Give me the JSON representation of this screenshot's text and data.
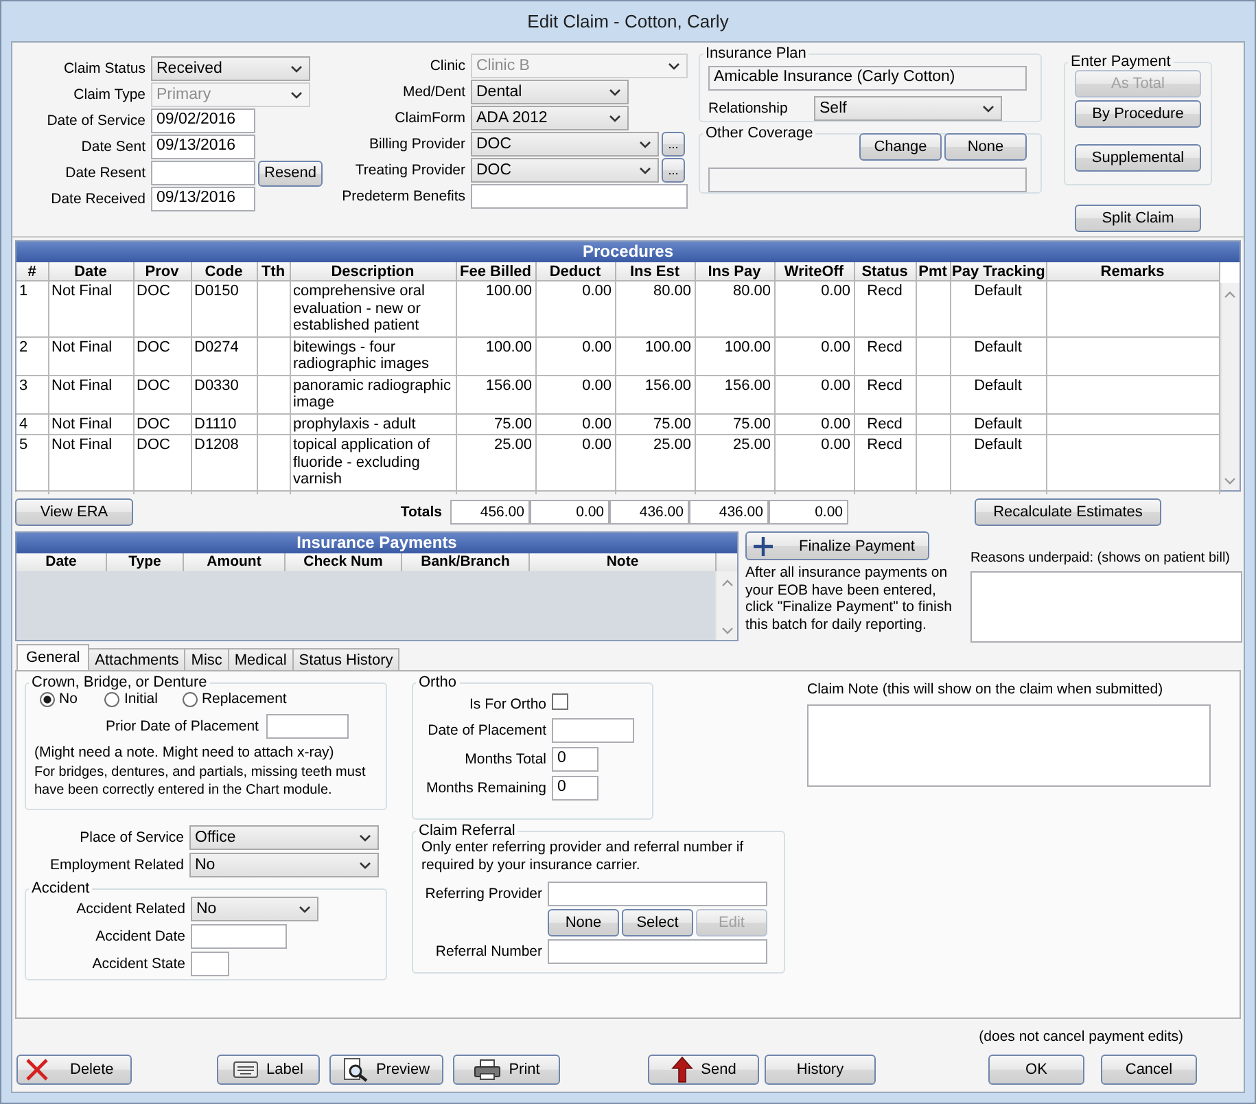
{
  "window": {
    "title": "Edit Claim - Cotton, Carly"
  },
  "claim_fields": [
    {
      "label": "Claim Status",
      "kind": "dropdown",
      "value": "Received",
      "disabled": false
    },
    {
      "label": "Claim Type",
      "kind": "dropdown",
      "value": "Primary",
      "disabled": true
    },
    {
      "label": "Date of Service",
      "kind": "text",
      "value": "09/02/2016",
      "disabled": false
    },
    {
      "label": "Date Sent",
      "kind": "text",
      "value": "09/13/2016",
      "disabled": false
    },
    {
      "label": "Date Resent",
      "kind": "text",
      "button": "Resend",
      "disabled": false
    },
    {
      "label": "Date Received",
      "kind": "text",
      "value": "09/13/2016",
      "disabled": false
    }
  ],
  "provider_fields": [
    {
      "label": "Clinic",
      "kind": "dropdown",
      "value": "Clinic B",
      "disabled": true
    },
    {
      "label": "Med/Dent",
      "kind": "dropdown",
      "value": "Dental",
      "disabled": false
    },
    {
      "label": "ClaimForm",
      "kind": "dropdown",
      "value": "ADA 2012",
      "disabled": false
    },
    {
      "label": "Billing Provider",
      "kind": "dropdown",
      "value": "DOC",
      "button": "...",
      "disabled": false
    },
    {
      "label": "Treating Provider",
      "kind": "dropdown",
      "value": "DOC",
      "button": "...",
      "disabled": false
    },
    {
      "label": "Predeterm Benefits",
      "kind": "text",
      "disabled": false
    }
  ],
  "insurance_plan": {
    "title": "Insurance Plan",
    "plan": "Amicable Insurance (Carly Cotton)",
    "relationship_label": "Relationship",
    "relationship": "Self"
  },
  "other_coverage": {
    "title": "Other Coverage",
    "buttons": [
      "Change",
      "None"
    ]
  },
  "enter_payment": {
    "title": "Enter Payment",
    "buttons": [
      {
        "label": "As Total",
        "disabled": true
      },
      {
        "label": "By Procedure",
        "disabled": false
      },
      {
        "label": "Supplemental",
        "disabled": false
      }
    ]
  },
  "split_claim": "Split Claim",
  "procedures": {
    "title": "Procedures",
    "columns": [
      "#",
      "Date",
      "Prov",
      "Code",
      "Tth",
      "Description",
      "Fee Billed",
      "Deduct",
      "Ins Est",
      "Ins Pay",
      "WriteOff",
      "Status",
      "Pmt",
      "Pay Tracking",
      "Remarks"
    ],
    "rows": [
      {
        "num": "1",
        "date": "Not Final",
        "prov": "DOC",
        "code": "D0150",
        "description": "comprehensive oral evaluation - new or established patient",
        "fee_billed": "100.00",
        "deduct": "0.00",
        "ins_est": "80.00",
        "ins_pay": "80.00",
        "writeoff": "0.00",
        "status": "Recd",
        "pay_tracking": "Default"
      },
      {
        "num": "2",
        "date": "Not Final",
        "prov": "DOC",
        "code": "D0274",
        "description": "bitewings - four radiographic images",
        "fee_billed": "100.00",
        "deduct": "0.00",
        "ins_est": "100.00",
        "ins_pay": "100.00",
        "writeoff": "0.00",
        "status": "Recd",
        "pay_tracking": "Default"
      },
      {
        "num": "3",
        "date": "Not Final",
        "prov": "DOC",
        "code": "D0330",
        "description": "panoramic radiographic image",
        "fee_billed": "156.00",
        "deduct": "0.00",
        "ins_est": "156.00",
        "ins_pay": "156.00",
        "writeoff": "0.00",
        "status": "Recd",
        "pay_tracking": "Default"
      },
      {
        "num": "4",
        "date": "Not Final",
        "prov": "DOC",
        "code": "D1110",
        "description": "prophylaxis - adult",
        "fee_billed": "75.00",
        "deduct": "0.00",
        "ins_est": "75.00",
        "ins_pay": "75.00",
        "writeoff": "0.00",
        "status": "Recd",
        "pay_tracking": "Default"
      },
      {
        "num": "5",
        "date": "Not Final",
        "prov": "DOC",
        "code": "D1208",
        "description": "topical application of fluoride - excluding varnish",
        "fee_billed": "25.00",
        "deduct": "0.00",
        "ins_est": "25.00",
        "ins_pay": "25.00",
        "writeoff": "0.00",
        "status": "Recd",
        "pay_tracking": "Default"
      }
    ]
  },
  "view_era": "View ERA",
  "totals": {
    "label": "Totals",
    "values": [
      "456.00",
      "0.00",
      "436.00",
      "436.00",
      "0.00"
    ]
  },
  "recalculate": "Recalculate Estimates",
  "insurance_payments": {
    "title": "Insurance Payments",
    "columns": [
      "Date",
      "Type",
      "Amount",
      "Check Num",
      "Bank/Branch",
      "Note"
    ]
  },
  "finalize": {
    "button": "Finalize Payment",
    "note": "After all insurance payments on your EOB have been entered, click \"Finalize Payment\" to finish this batch for daily reporting."
  },
  "reasons_underpaid": {
    "label": "Reasons underpaid:  (shows on patient bill)"
  },
  "tabs": [
    {
      "label": "General",
      "selected": true
    },
    {
      "label": "Attachments",
      "selected": false
    },
    {
      "label": "Misc",
      "selected": false
    },
    {
      "label": "Medical",
      "selected": false
    },
    {
      "label": "Status History",
      "selected": false
    }
  ],
  "general": {
    "crown": {
      "title": "Crown, Bridge, or Denture",
      "options": [
        {
          "label": "No",
          "selected": true
        },
        {
          "label": "Initial",
          "selected": false
        },
        {
          "label": "Replacement",
          "selected": false
        }
      ],
      "prior_date_label": "Prior Date of Placement",
      "note": "(Might need a note. Might need to attach x-ray)",
      "warning": "For bridges, dentures, and partials, missing teeth must have been correctly entered in the Chart module."
    },
    "service_fields": [
      {
        "label": "Place of Service",
        "value": "Office"
      },
      {
        "label": "Employment Related",
        "value": "No"
      }
    ],
    "accident": {
      "title": "Accident",
      "fields": [
        {
          "label": "Accident Related",
          "kind": "dropdown",
          "value": "No"
        },
        {
          "label": "Accident Date",
          "kind": "date"
        },
        {
          "label": "Accident State",
          "kind": "state"
        }
      ]
    },
    "ortho": {
      "title": "Ortho",
      "is_for_ortho": {
        "label": "Is For Ortho",
        "checked": false
      },
      "fields": [
        {
          "label": "Date of Placement",
          "kind": "date"
        },
        {
          "label": "Months Total",
          "kind": "count",
          "value": "0"
        },
        {
          "label": "Months Remaining",
          "kind": "count",
          "value": "0"
        }
      ]
    },
    "referral": {
      "title": "Claim Referral",
      "note": "Only enter referring provider and referral number if required by your insurance carrier.",
      "provider_label": "Referring Provider",
      "buttons": [
        {
          "label": "None",
          "disabled": false
        },
        {
          "label": "Select",
          "disabled": false
        },
        {
          "label": "Edit",
          "disabled": true
        }
      ],
      "number_label": "Referral Number"
    },
    "claim_note": {
      "label": "Claim Note (this will show on the claim when submitted)"
    }
  },
  "footer": {
    "note": "(does not cancel payment edits)",
    "buttons": [
      {
        "label": "Delete",
        "kind": "delete"
      },
      {
        "label": "Label",
        "kind": "label"
      },
      {
        "label": "Preview",
        "kind": "preview"
      },
      {
        "label": "Print",
        "kind": "print"
      },
      {
        "label": "Send",
        "kind": "send"
      },
      {
        "label": "History",
        "kind": "plain"
      },
      {
        "label": "OK",
        "kind": "plain"
      },
      {
        "label": "Cancel",
        "kind": "plain"
      }
    ]
  }
}
